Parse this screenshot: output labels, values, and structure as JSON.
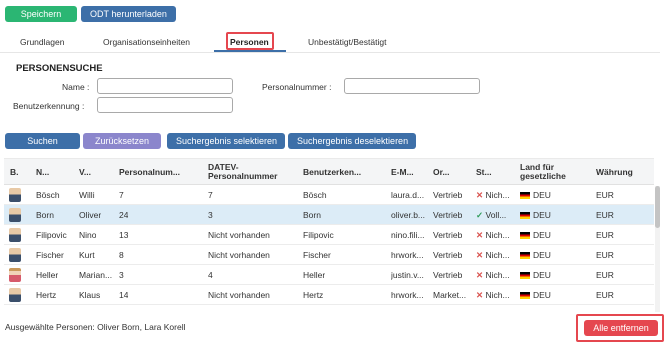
{
  "toolbar": {
    "save_label": "Speichern",
    "download_label": "ODT herunterladen"
  },
  "tabs": [
    {
      "label": "Grundlagen"
    },
    {
      "label": "Organisationseinheiten"
    },
    {
      "label": "Personen"
    },
    {
      "label": "Unbestätigt/Bestätigt"
    }
  ],
  "search": {
    "title": "PERSONENSUCHE",
    "name_label": "Name :",
    "name_value": "",
    "personnel_label": "Personalnummer :",
    "personnel_value": "",
    "username_label": "Benutzerkennung :",
    "username_value": ""
  },
  "actions": {
    "search": "Suchen",
    "reset": "Zurücksetzen",
    "select_result": "Suchergebnis selektieren",
    "deselect_result": "Suchergebnis deselektieren"
  },
  "table": {
    "headers": [
      "B.",
      "N...",
      "V...",
      "Personalnum...",
      "DATEV-Personalnummer",
      "Benutzerken...",
      "E-M...",
      "Or...",
      "St...",
      "Land für gesetzliche",
      "Währung"
    ],
    "rows": [
      {
        "name": "Bösch",
        "vorname": "Willi",
        "pnr": "7",
        "datev": "7",
        "user": "Bösch",
        "email": "laura.d...",
        "org": "Vertrieb",
        "status": "Nich...",
        "status_ok": false,
        "land": "DEU",
        "currency": "EUR",
        "avatar": "male"
      },
      {
        "name": "Born",
        "vorname": "Oliver",
        "pnr": "24",
        "datev": "3",
        "user": "Born",
        "email": "oliver.b...",
        "org": "Vertrieb",
        "status": "Voll...",
        "status_ok": true,
        "land": "DEU",
        "currency": "EUR",
        "avatar": "male"
      },
      {
        "name": "Filipovic",
        "vorname": "Nino",
        "pnr": "13",
        "datev": "Nicht vorhanden",
        "user": "Filipovic",
        "email": "nino.fili...",
        "org": "Vertrieb",
        "status": "Nich...",
        "status_ok": false,
        "land": "DEU",
        "currency": "EUR",
        "avatar": "male"
      },
      {
        "name": "Fischer",
        "vorname": "Kurt",
        "pnr": "8",
        "datev": "Nicht vorhanden",
        "user": "Fischer",
        "email": "hrwork...",
        "org": "Vertrieb",
        "status": "Nich...",
        "status_ok": false,
        "land": "DEU",
        "currency": "EUR",
        "avatar": "male"
      },
      {
        "name": "Heller",
        "vorname": "Marian...",
        "pnr": "3",
        "datev": "4",
        "user": "Heller",
        "email": "justin.v...",
        "org": "Vertrieb",
        "status": "Nich...",
        "status_ok": false,
        "land": "DEU",
        "currency": "EUR",
        "avatar": "female"
      },
      {
        "name": "Hertz",
        "vorname": "Klaus",
        "pnr": "14",
        "datev": "Nicht vorhanden",
        "user": "Hertz",
        "email": "hrwork...",
        "org": "Market...",
        "status": "Nich...",
        "status_ok": false,
        "land": "DEU",
        "currency": "EUR",
        "avatar": "male"
      }
    ],
    "status_icons": {
      "not": "✕",
      "ok": "✓"
    }
  },
  "footer": {
    "selected_text": "Ausgewählte Personen: Oliver Born, Lara Korell",
    "remove_all": "Alle entfernen"
  },
  "colors": {
    "primary": "#3d6fa8",
    "success": "#2bb673",
    "danger": "#e5474f",
    "highlight": "#e5474f",
    "selected_row": "#dcecf7"
  }
}
